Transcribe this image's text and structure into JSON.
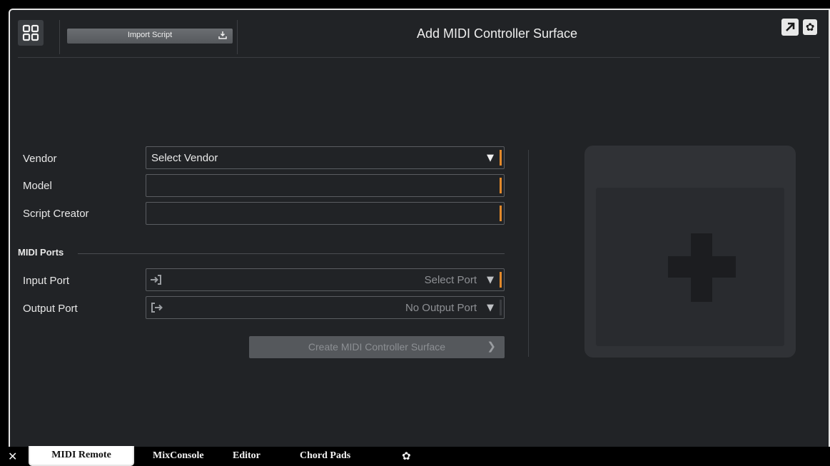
{
  "window": {
    "title": "Add MIDI Controller Surface"
  },
  "toolbar": {
    "import_label": "Import Script"
  },
  "form": {
    "vendor_label": "Vendor",
    "vendor_value": "Select Vendor",
    "model_label": "Model",
    "model_value": "",
    "creator_label": "Script Creator",
    "creator_value": ""
  },
  "ports": {
    "section_title": "MIDI Ports",
    "input_label": "Input Port",
    "input_value": "Select Port",
    "output_label": "Output Port",
    "output_value": "No Output Port"
  },
  "create_button_label": "Create MIDI Controller Surface",
  "tabs": [
    {
      "label": "MIDI Remote",
      "active": true
    },
    {
      "label": "MixConsole",
      "active": false
    },
    {
      "label": "Editor",
      "active": false
    },
    {
      "label": "Chord Pads",
      "active": false
    }
  ],
  "colors": {
    "accent": "#e3892b",
    "panel_bg": "#212326",
    "preview_bg": "#303236"
  }
}
